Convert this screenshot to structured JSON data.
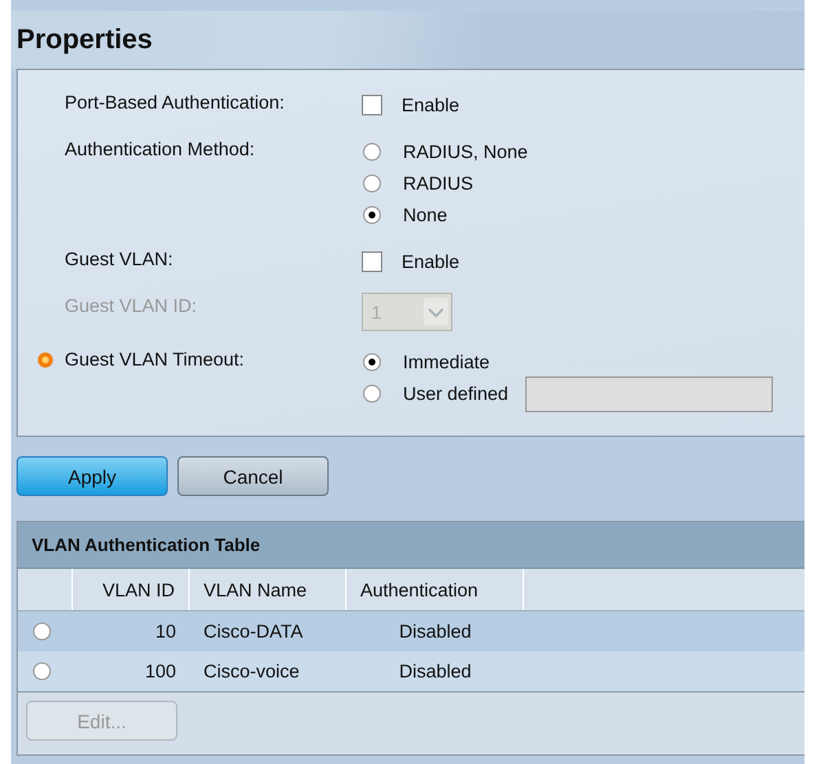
{
  "title": "Properties",
  "form": [
    {
      "kind": "checkbox",
      "label": "Port-Based Authentication:",
      "option": "Enable",
      "checked": false
    },
    {
      "kind": "radio",
      "label": "Authentication Method:",
      "options": [
        {
          "label": "RADIUS, None",
          "selected": false
        },
        {
          "label": "RADIUS",
          "selected": false
        },
        {
          "label": "None",
          "selected": true
        }
      ]
    },
    {
      "kind": "checkbox",
      "label": "Guest VLAN:",
      "option": "Enable",
      "checked": false
    },
    {
      "kind": "select",
      "label": "Guest VLAN ID:",
      "value": "1",
      "disabled": true
    },
    {
      "kind": "radio",
      "label": "Guest VLAN Timeout:",
      "required": true,
      "options": [
        {
          "label": "Immediate",
          "selected": true,
          "field": false
        },
        {
          "label": "User defined",
          "selected": false,
          "field": true
        }
      ]
    }
  ],
  "buttons": [
    {
      "label": "Apply",
      "primary": true
    },
    {
      "label": "Cancel",
      "primary": false
    }
  ],
  "table": {
    "title": "VLAN Authentication Table",
    "columns": [
      "VLAN ID",
      "VLAN Name",
      "Authentication"
    ],
    "rows": [
      {
        "selected": false,
        "highlighted": true,
        "cells": [
          "10",
          "Cisco-DATA",
          "Disabled"
        ]
      },
      {
        "selected": false,
        "highlighted": false,
        "cells": [
          "100",
          "Cisco-voice",
          "Disabled"
        ]
      }
    ],
    "edit_button": {
      "label": "Edit...",
      "disabled": true
    }
  }
}
